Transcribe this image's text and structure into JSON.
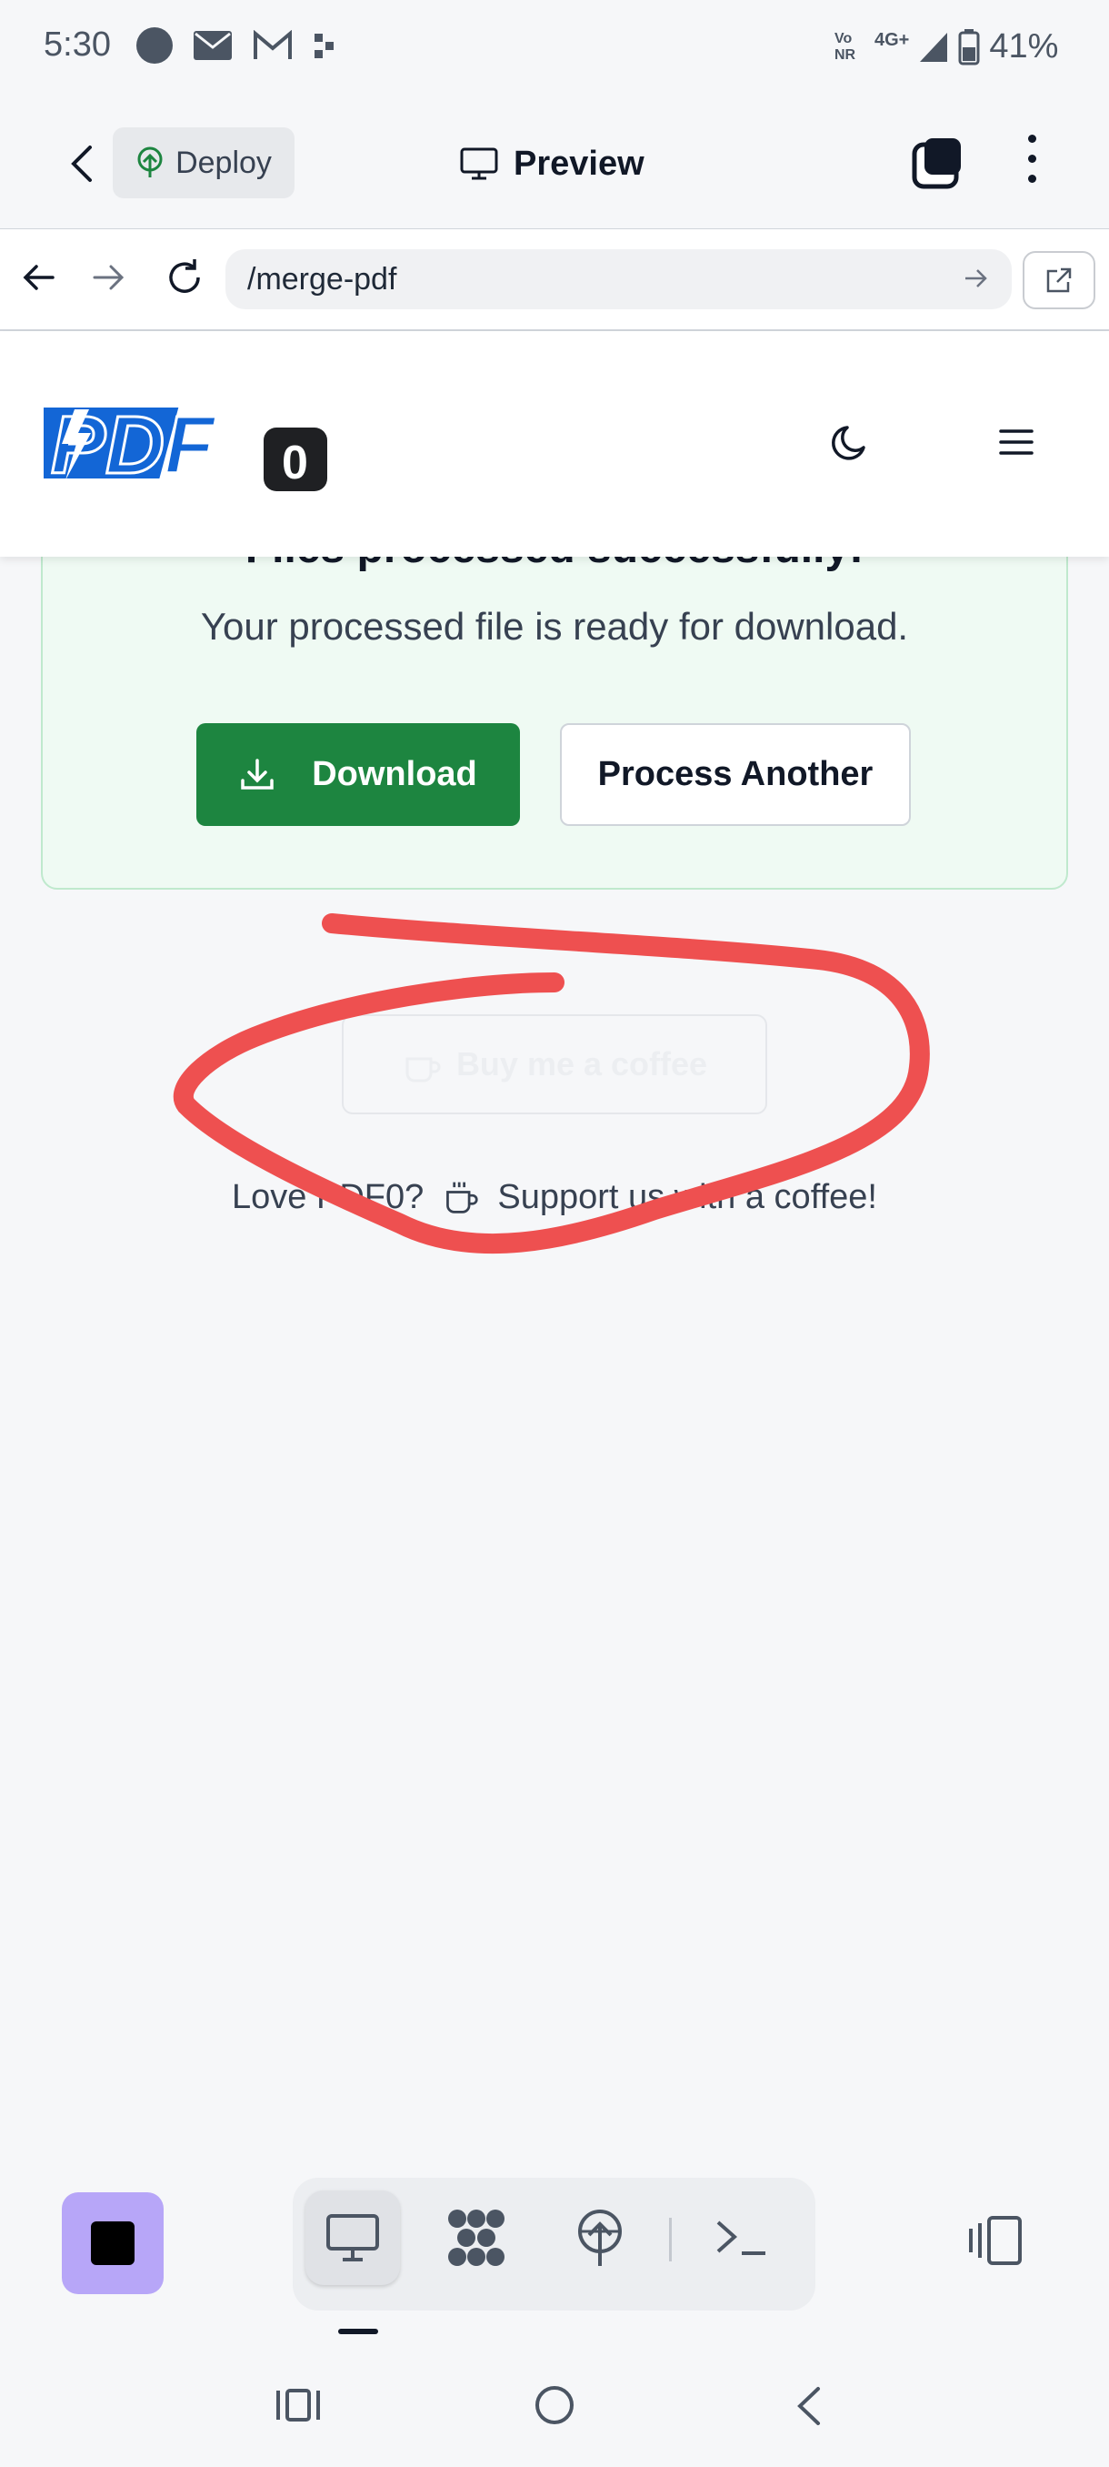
{
  "status_bar": {
    "time": "5:30",
    "battery": "41%",
    "network": "4G+",
    "volte": "Vo NR"
  },
  "app_header": {
    "deploy_label": "Deploy",
    "preview_label": "Preview"
  },
  "address_bar": {
    "url": "/merge-pdf"
  },
  "site": {
    "logo_text": "PDF",
    "logo_badge": "0"
  },
  "result_card": {
    "title": "Files processed successfully!",
    "description": "Your processed file is ready for download.",
    "download_label": "Download",
    "process_another_label": "Process Another"
  },
  "coffee": {
    "button_label": "Buy me a coffee",
    "support_prefix": "Love PDF0?",
    "support_suffix": "Support us with a coffee!"
  },
  "colors": {
    "download_green": "#1d8540",
    "card_bg": "#effaf3",
    "logo_blue": "#1366d6",
    "stop_purple": "#b7a6f8",
    "scribble_red": "#ee5050"
  }
}
